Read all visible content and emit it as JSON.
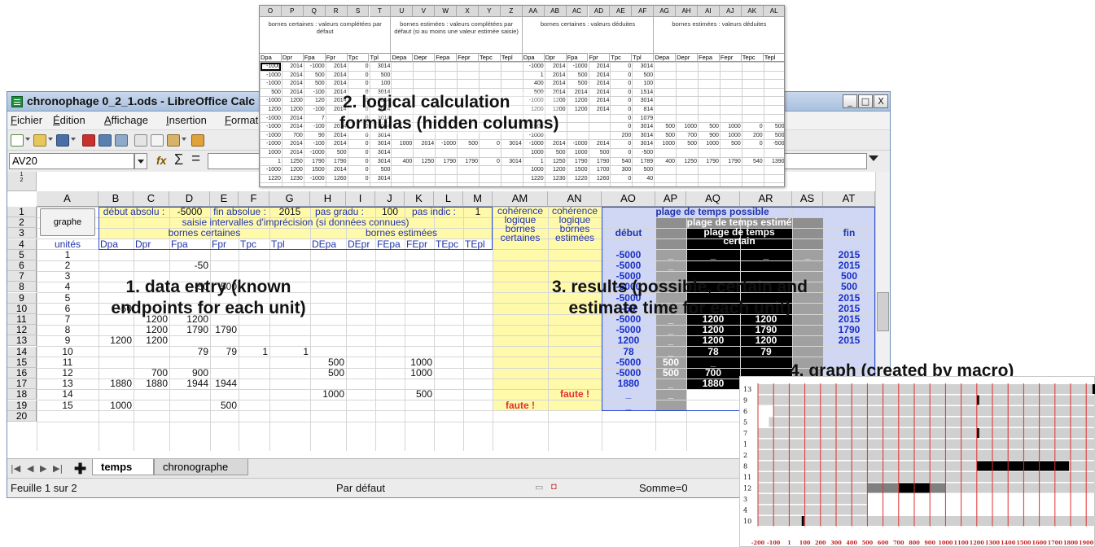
{
  "window": {
    "title": "chronophage 0_2_1.ods - LibreOffice Calc",
    "controls": [
      "_",
      "□",
      "X"
    ]
  },
  "menu": [
    "Fichier",
    "Édition",
    "Affichage",
    "Insertion",
    "Format"
  ],
  "formula_bar": {
    "cell_ref": "AV20",
    "fx": "fx",
    "sum": "Σ",
    "eq": "="
  },
  "columns": {
    "A": "A",
    "B": "B",
    "C": "C",
    "D": "D",
    "E": "E",
    "F": "F",
    "G": "G",
    "H": "H",
    "I": "I",
    "J": "J",
    "K": "K",
    "L": "L",
    "M": "M",
    "AM": "AM",
    "AN": "AN",
    "AO": "AO",
    "AP": "AP",
    "AQ": "AQ",
    "AR": "AR",
    "AS": "AS",
    "AT": "AT"
  },
  "sheet": {
    "graphe_button": "graphe",
    "row1": {
      "debut_absolu": "début absolu :",
      "debut_val": "-5000",
      "fin_absolue": "fin absolue :",
      "fin_val": "2015",
      "pas_gradu": "pas gradu :",
      "pas_gradu_val": "100",
      "pas_indic": "pas indic :",
      "pas_indic_val": "1"
    },
    "row2_saisie": "saisie intervalles d'imprécision (si données connues)",
    "row3_bornes_certaines": "bornes certaines",
    "row3_bornes_estimees": "bornes estimées",
    "coherence_certaines": "cohérence logique bornes certaines",
    "coherence_estimees": "cohérence logique bornes estimées",
    "plage_possible": "plage de temps possible",
    "plage_estime": "plage de temps estimé",
    "plage_certain": "plage de temps certain",
    "debut": "début",
    "fin": "fin",
    "row4": [
      "unités",
      "Dpa",
      "Dpr",
      "Fpa",
      "Fpr",
      "Tpc",
      "Tpl",
      "DEpa",
      "DEpr",
      "FEpa",
      "FEpr",
      "TEpc",
      "TEpl"
    ],
    "row_numbers": [
      "1",
      "2",
      "3",
      "4",
      "5",
      "6",
      "7",
      "8",
      "9",
      "10",
      "11",
      "12",
      "13",
      "14",
      "15",
      "16",
      "17",
      "18",
      "19",
      "20"
    ],
    "units": [
      "1",
      "2",
      "3",
      "4",
      "5",
      "6",
      "7",
      "8",
      "9",
      "10",
      "11",
      "12",
      "13",
      "14",
      "15"
    ],
    "data": {
      "r6_D": "-50",
      "r8_D": "-50",
      "r8_E": "500",
      "r10_B": "-50",
      "r11_C": "1200",
      "r11_D": "1200",
      "r12_C": "1200",
      "r12_D": "1790",
      "r12_E": "1790",
      "r13_B": "1200",
      "r13_C": "1200",
      "r14_D": "79",
      "r14_E": "79",
      "r14_F": "1",
      "r14_G": "1",
      "r15_H": "500",
      "r15_K": "1000",
      "r16_C": "700",
      "r16_D": "900",
      "r16_H": "500",
      "r16_K": "1000",
      "r17_B": "1880",
      "r17_C": "1880",
      "r17_D": "1944",
      "r17_E": "1944",
      "r18_H": "1000",
      "r18_K": "500",
      "r19_B": "1000",
      "r19_E": "500"
    },
    "faute": "faute !",
    "results": {
      "AO": [
        "-5000",
        "-5000",
        "-5000",
        "-5000",
        "-5000",
        "-50",
        "-5000",
        "-5000",
        "1200",
        "78",
        "-5000",
        "-5000",
        "1880",
        "_",
        "_"
      ],
      "AP": [
        "_",
        "_",
        "",
        "",
        "",
        "",
        "_",
        "_",
        "_",
        "_",
        "500",
        "500",
        "_",
        "_",
        ""
      ],
      "AQ": [
        "_",
        "",
        "",
        "",
        "",
        "",
        "1200",
        "1200",
        "1200",
        "78",
        "_",
        "700",
        "1880",
        "_",
        "_"
      ],
      "AR": [
        "_",
        "",
        "",
        "",
        "",
        "",
        "1200",
        "1790",
        "1200",
        "79",
        "",
        "",
        "",
        "",
        ""
      ],
      "AS": [
        "_",
        "",
        "",
        "",
        "",
        "",
        "",
        "",
        "",
        "",
        "",
        "",
        "",
        "",
        ""
      ],
      "AT": [
        "2015",
        "2015",
        "500",
        "500",
        "2015",
        "2015",
        "2015",
        "1790",
        "2015",
        "",
        "",
        "",
        "",
        "",
        ""
      ]
    }
  },
  "tabs": {
    "temps": "temps",
    "chronographe": "chronographe"
  },
  "status": {
    "sheet": "Feuille 1 sur 2",
    "style": "Par défaut",
    "sum": "Somme=0"
  },
  "hidden": {
    "col_letters": [
      "O",
      "P",
      "Q",
      "R",
      "S",
      "T",
      "U",
      "V",
      "W",
      "X",
      "Y",
      "Z",
      "AA",
      "AB",
      "AC",
      "AD",
      "AE",
      "AF",
      "AG",
      "AH",
      "AI",
      "AJ",
      "AK",
      "AL"
    ],
    "groups": [
      "bornes certaines : valeurs complétées par défaut",
      "bornes estimées : valeurs complétées par défaut (si au moins une valeur estimée saisie)",
      "bornes certaines : valeurs déduites",
      "bornes estimées : valeurs déduites"
    ],
    "subheaders": [
      "Dpa",
      "Dpr",
      "Fpa",
      "Fpr",
      "Tpc",
      "Tpl",
      "Depa",
      "Depr",
      "Fepa",
      "Fepr",
      "Tepc",
      "Tepl",
      "Dpa",
      "Dpr",
      "Fpa",
      "Fpr",
      "Tpc",
      "Tpl",
      "Depa",
      "Depr",
      "Fepa",
      "Fepr",
      "Tepc",
      "Tepl"
    ],
    "rows": [
      [
        "-1000",
        "2014",
        "-1000",
        "2014",
        "0",
        "3014",
        "",
        "",
        "",
        "",
        "",
        "",
        "-1000",
        "2014",
        "-1000",
        "2014",
        "0",
        "3014",
        "",
        "",
        "",
        "",
        "",
        ""
      ],
      [
        "-1000",
        "2014",
        "500",
        "2014",
        "0",
        "500",
        "",
        "",
        "",
        "",
        "",
        "",
        "1",
        "2014",
        "500",
        "2014",
        "0",
        "500",
        "",
        "",
        "",
        "",
        "",
        ""
      ],
      [
        "-1000",
        "2014",
        "500",
        "2014",
        "0",
        "100",
        "",
        "",
        "",
        "",
        "",
        "",
        "400",
        "2014",
        "500",
        "2014",
        "0",
        "100",
        "",
        "",
        "",
        "",
        "",
        ""
      ],
      [
        "500",
        "2014",
        "-100",
        "2014",
        "0",
        "3014",
        "",
        "",
        "",
        "",
        "",
        "",
        "500",
        "2014",
        "2014",
        "2014",
        "0",
        "1514",
        "",
        "",
        "",
        "",
        "",
        ""
      ],
      [
        "-1000",
        "1200",
        "120",
        "2014",
        "0",
        "3014",
        "",
        "",
        "",
        "",
        "",
        "",
        "-1000",
        "1200",
        "1200",
        "2014",
        "0",
        "3014",
        "",
        "",
        "",
        "",
        "",
        ""
      ],
      [
        "1200",
        "1200",
        "-100",
        "2014",
        "0",
        "3014",
        "",
        "",
        "",
        "",
        "",
        "",
        "1200",
        "1200",
        "1200",
        "2014",
        "0",
        "814",
        "",
        "",
        "",
        "",
        "",
        ""
      ],
      [
        "-1000",
        "2014",
        "7",
        "",
        "0",
        "3014",
        "",
        "",
        "",
        "",
        "",
        "",
        "",
        "",
        "",
        "",
        "0",
        "1079",
        "",
        "",
        "",
        "",
        "",
        ""
      ],
      [
        "-1000",
        "2014",
        "-100",
        "2014",
        "0",
        "3014",
        "",
        "",
        "",
        "",
        "",
        "",
        "-1000",
        "",
        "",
        "",
        "0",
        "3014",
        "500",
        "1000",
        "500",
        "1000",
        "0",
        "500"
      ],
      [
        "-1000",
        "700",
        "90",
        "2014",
        "0",
        "3014",
        "",
        "",
        "",
        "",
        "",
        "",
        "-1000",
        "",
        "",
        "",
        "200",
        "3014",
        "500",
        "700",
        "900",
        "1000",
        "200",
        "500"
      ],
      [
        "-1000",
        "2014",
        "-100",
        "2014",
        "0",
        "3014",
        "1000",
        "2014",
        "-1000",
        "500",
        "0",
        "3014",
        "-1000",
        "2014",
        "-1000",
        "2014",
        "0",
        "3014",
        "1000",
        "500",
        "1000",
        "500",
        "0",
        "-500"
      ],
      [
        "1000",
        "2014",
        "-1000",
        "500",
        "0",
        "3014",
        "",
        "",
        "",
        "",
        "",
        "",
        "1000",
        "500",
        "1000",
        "500",
        "0",
        "-500",
        "",
        "",
        "",
        "",
        "",
        ""
      ],
      [
        "1",
        "1250",
        "1790",
        "1790",
        "0",
        "3014",
        "400",
        "1250",
        "1790",
        "1790",
        "0",
        "3014",
        "1",
        "1250",
        "1790",
        "1790",
        "540",
        "1789",
        "400",
        "1250",
        "1790",
        "1790",
        "540",
        "1390"
      ],
      [
        "-1000",
        "1200",
        "1500",
        "2014",
        "0",
        "500",
        "",
        "",
        "",
        "",
        "",
        "",
        "1000",
        "1200",
        "1500",
        "1700",
        "300",
        "500",
        "",
        "",
        "",
        "",
        "",
        ""
      ],
      [
        "1220",
        "1230",
        "-1000",
        "1260",
        "0",
        "3014",
        "",
        "",
        "",
        "",
        "",
        "",
        "1220",
        "1230",
        "1220",
        "1260",
        "0",
        "40",
        "",
        "",
        "",
        "",
        "",
        ""
      ]
    ]
  },
  "captions": {
    "c1": [
      "1. data entry (known",
      "endpoints for each unit)"
    ],
    "c2": [
      "2. logical calculation",
      "formulas (hidden columns)"
    ],
    "c3": [
      "3. results (possible, certain and",
      "estimate time for each unit)"
    ],
    "c4": "4. graph (created by macro)"
  },
  "graph": {
    "row_labels": [
      "13",
      "9",
      "6",
      "5",
      "7",
      "1",
      "2",
      "8",
      "11",
      "12",
      "3",
      "4",
      "10"
    ],
    "x_labels": [
      "-200",
      "-100",
      "1",
      "100",
      "200",
      "300",
      "400",
      "500",
      "600",
      "700",
      "800",
      "900",
      "1000",
      "1100",
      "1200",
      "1300",
      "1400",
      "1500",
      "1600",
      "1700",
      "1800",
      "1900"
    ],
    "colors": {
      "possible": "#d0d0d0",
      "estimate": "#808080",
      "certain": "#000000",
      "grid": "#e03030"
    }
  }
}
